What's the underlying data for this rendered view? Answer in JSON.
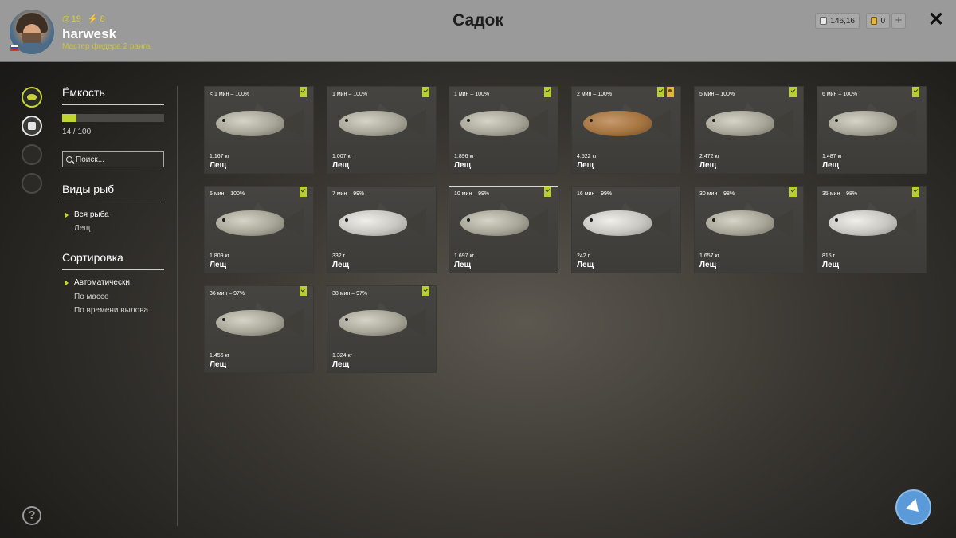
{
  "header": {
    "title": "Садок",
    "level": "19",
    "energy": "8",
    "username": "harwesk",
    "rank": "Мастер фидера 2 ранга",
    "silver": "146,16",
    "gold": "0",
    "plus": "+",
    "close": "✕"
  },
  "sidebar": {
    "capacity_heading": "Ёмкость",
    "capacity_text": "14 / 100",
    "capacity_fraction": 0.14,
    "search_placeholder": "Поиск...",
    "species_heading": "Виды рыб",
    "species": [
      "Вся рыба",
      "Лещ"
    ],
    "sort_heading": "Сортировка",
    "sort_options": [
      "Автоматически",
      "По массе",
      "По времени вылова"
    ],
    "help": "?"
  },
  "fish": [
    {
      "time": "< 1 мин – 100%",
      "weight": "1.167 кг",
      "name": "Лещ"
    },
    {
      "time": "1 мин – 100%",
      "weight": "1.007 кг",
      "name": "Лещ"
    },
    {
      "time": "1 мин – 100%",
      "weight": "1.896 кг",
      "name": "Лещ"
    },
    {
      "time": "2 мин – 100%",
      "weight": "4.522 кг",
      "name": "Лещ"
    },
    {
      "time": "5 мин – 100%",
      "weight": "2.472 кг",
      "name": "Лещ"
    },
    {
      "time": "6 мин – 100%",
      "weight": "1.487 кг",
      "name": "Лещ"
    },
    {
      "time": "6 мин – 100%",
      "weight": "1.809 кг",
      "name": "Лещ"
    },
    {
      "time": "7 мин – 99%",
      "weight": "332 г",
      "name": "Лещ"
    },
    {
      "time": "10 мин – 99%",
      "weight": "1.697 кг",
      "name": "Лещ"
    },
    {
      "time": "16 мин – 99%",
      "weight": "242 г",
      "name": "Лещ"
    },
    {
      "time": "30 мин – 98%",
      "weight": "1.657 кг",
      "name": "Лещ"
    },
    {
      "time": "35 мин – 98%",
      "weight": "815 г",
      "name": "Лещ"
    },
    {
      "time": "36 мин – 97%",
      "weight": "1.456 кг",
      "name": "Лещ"
    },
    {
      "time": "38 мин – 97%",
      "weight": "1.324 кг",
      "name": "Лещ"
    }
  ]
}
